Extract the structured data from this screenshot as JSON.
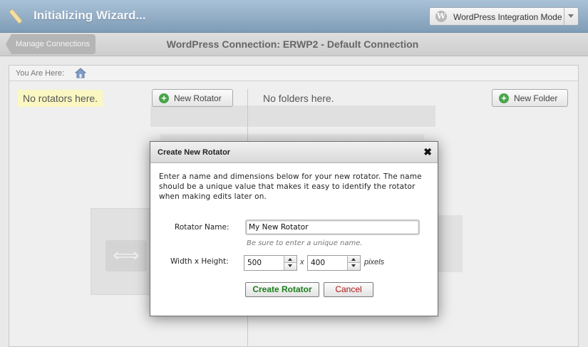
{
  "header": {
    "title": "Initializing Wizard...",
    "mode_select": {
      "value": "WordPress Integration Mode",
      "icon": "wordpress-icon"
    }
  },
  "subheader": {
    "back_label": "Manage Connections",
    "connection_title": "WordPress Connection: ERWP2 - Default Connection"
  },
  "breadcrumb": {
    "label": "You Are Here:",
    "icon": "home-icon"
  },
  "rotators": {
    "empty_text": "No rotators here.",
    "new_button": "New Rotator"
  },
  "folders": {
    "empty_text": "No folders here.",
    "new_button": "New Folder"
  },
  "modal": {
    "title": "Create New Rotator",
    "close_symbol": "✖",
    "description": "Enter a name and dimensions below for your new rotator.  The name should be a unique value that makes it easy to identify the rotator when making edits later on.",
    "name_label": "Rotator Name:",
    "name_value": "My New Rotator",
    "name_hint": "Be sure to enter a unique name.",
    "size_label": "Width x Height:",
    "width_value": "500",
    "height_value": "400",
    "times_symbol": "x",
    "units": "pixels",
    "create_button": "Create Rotator",
    "cancel_button": "Cancel"
  },
  "colors": {
    "header_blue": "#8fa9c2",
    "note_yellow": "#fbf7c2",
    "create_green": "#1b7d1b",
    "cancel_red": "#b01414"
  }
}
